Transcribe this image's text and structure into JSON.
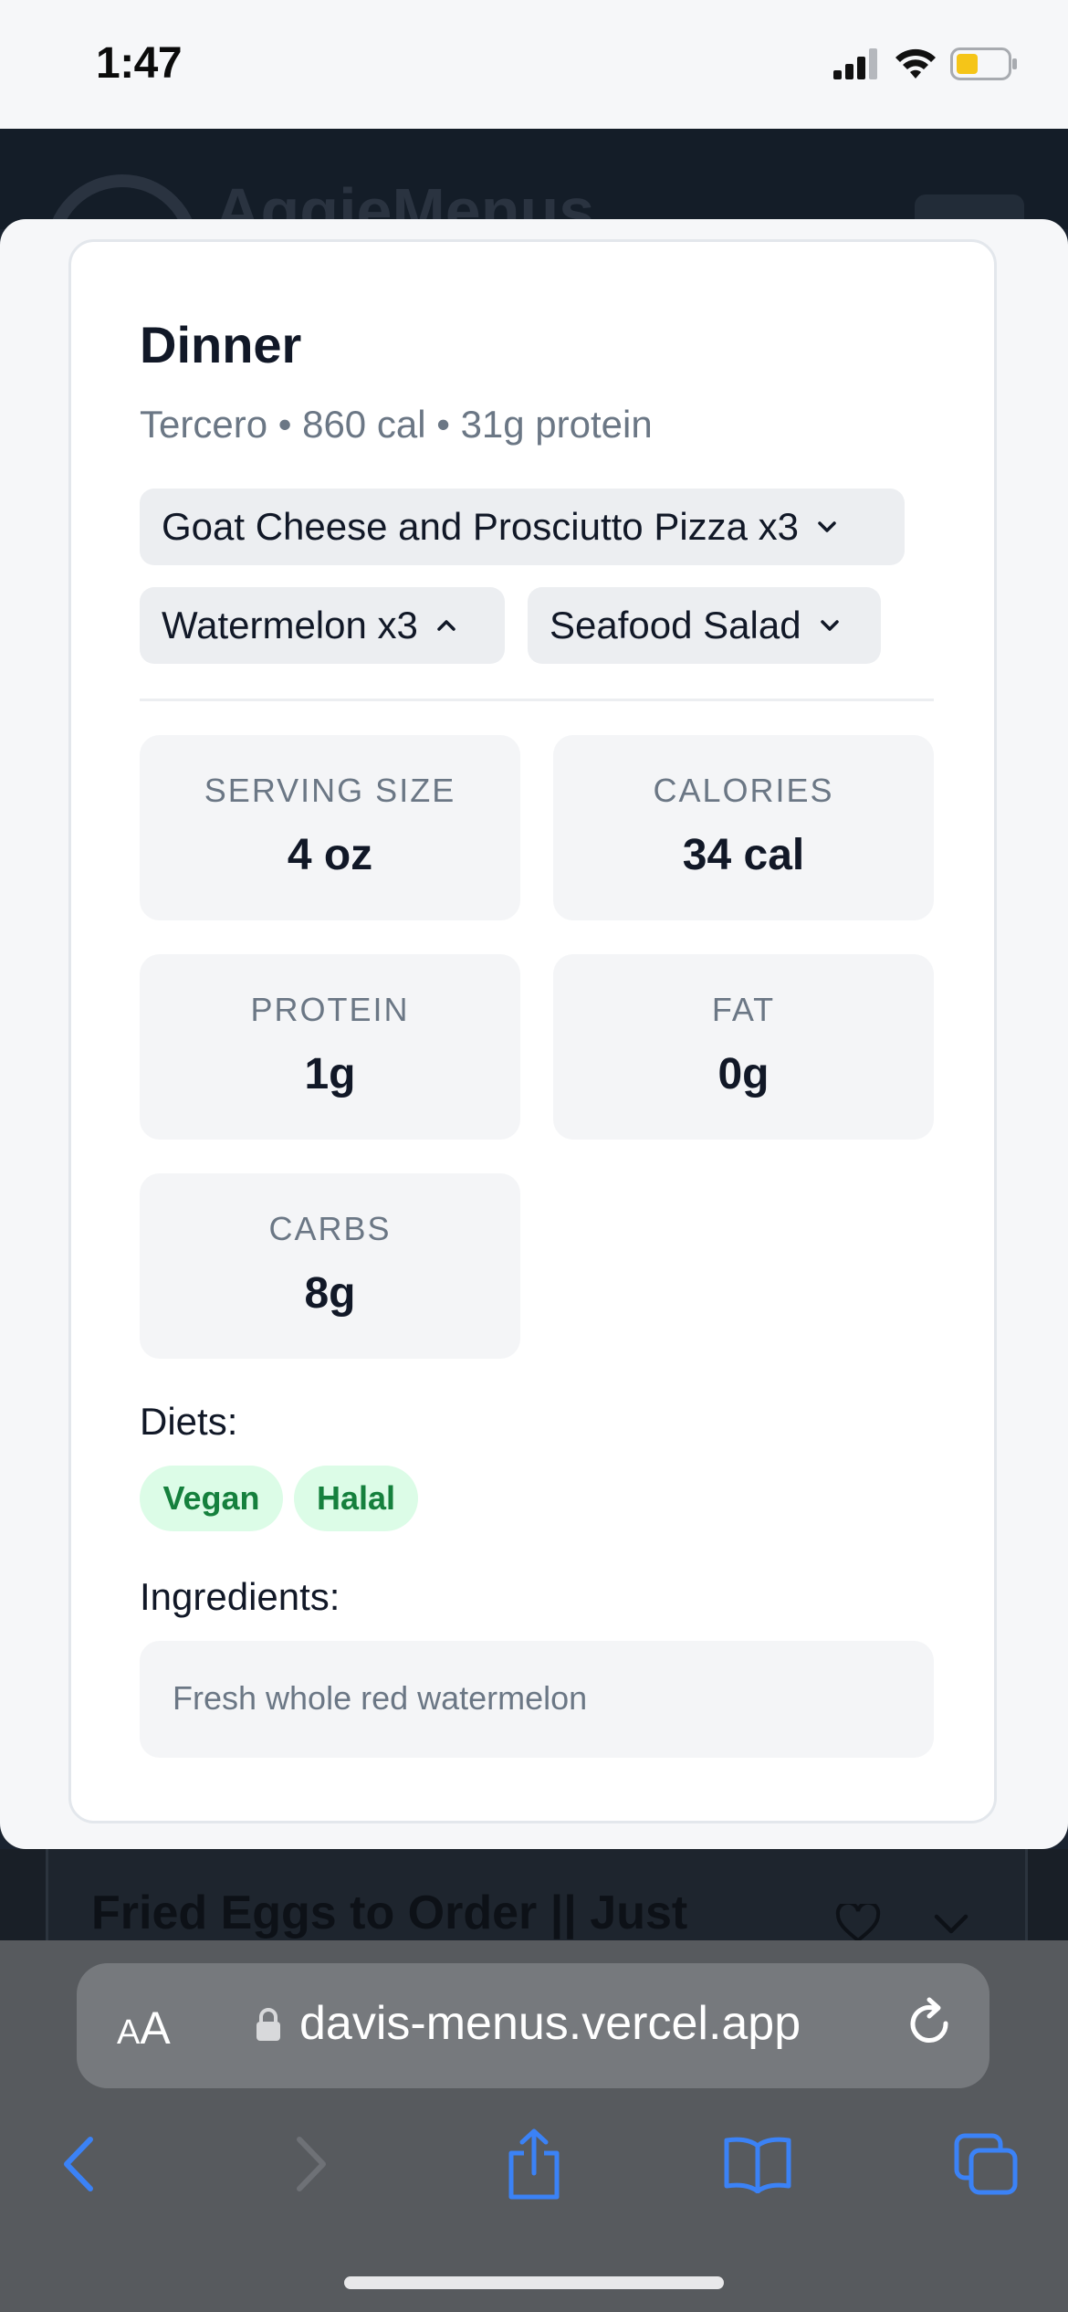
{
  "status_bar": {
    "time": "1:47"
  },
  "site_header": {
    "title": "AggieMenus"
  },
  "meal_card": {
    "title": "Dinner",
    "subtitle": "Tercero • 860 cal • 31g protein",
    "items": [
      {
        "label": "Goat Cheese and Prosciutto Pizza x3",
        "expanded": false
      },
      {
        "label": "Watermelon x3",
        "expanded": true
      },
      {
        "label": "Seafood Salad",
        "expanded": false
      }
    ],
    "nutrition": {
      "serving_size": {
        "label": "SERVING SIZE",
        "value": "4 oz"
      },
      "calories": {
        "label": "CALORIES",
        "value": "34 cal"
      },
      "protein": {
        "label": "PROTEIN",
        "value": "1g"
      },
      "fat": {
        "label": "FAT",
        "value": "0g"
      },
      "carbs": {
        "label": "CARBS",
        "value": "8g"
      }
    },
    "diets_label": "Diets:",
    "diets": [
      "Vegan",
      "Halal"
    ],
    "ingredients_label": "Ingredients:",
    "ingredients": "Fresh whole red watermelon"
  },
  "background_item": {
    "title": "Fried Eggs to Order || Just"
  },
  "browser": {
    "aa_small": "A",
    "aa_big": "A",
    "url": "davis-menus.vercel.app"
  },
  "colors": {
    "diet_badge_bg": "#dcfce7",
    "diet_badge_text": "#15803d",
    "safari_blue": "#3b82f6"
  }
}
